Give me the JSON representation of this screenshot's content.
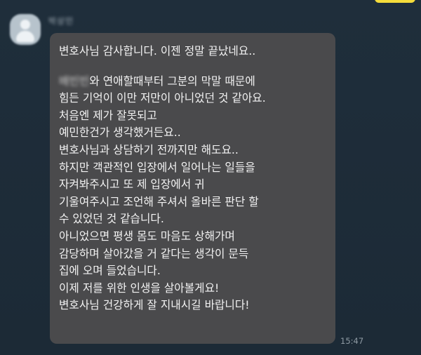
{
  "chat": {
    "sender_name": "박상민",
    "message_lines": [
      "변호사님 감사합니다. 이젠 정말 끝났네요..",
      "와 연애할때부터 그분의 막말 때문에",
      "힘든 기억이 이만 저만이 아니었던 것 같아요.",
      "처음엔 제가 잘못되고",
      "예민한건가 생각했거든요..",
      "변호사님과 상담하기 전까지만 해도요..",
      "하지만 객관적인 입장에서 일어나는 일들을",
      "자켜봐주시고 또 제 입장에서 귀",
      "기울여주시고 조언해 주셔서 올바른 판단 할",
      "수 있었던 것 같습니다.",
      "아니었으면 평생 몸도 마음도 상해가며",
      "감당하며 살아갔을 거 같다는 생각이 문득",
      "집에 오며 들었습니다.",
      "이제 저를 위한 인생을 살아볼게요!",
      "변호사님 건강하게 잘 지내시길 바랍니다!"
    ],
    "redacted_name": "배빈빈",
    "time": "15:47"
  },
  "colors": {
    "background": "#1d2b38",
    "bubble": "#4a4a4c",
    "message_text": "#f3f3f3",
    "time_text": "#8e9aa3",
    "accent": "#f5dc3b"
  },
  "icons": {
    "avatar": "default-profile-avatar"
  }
}
